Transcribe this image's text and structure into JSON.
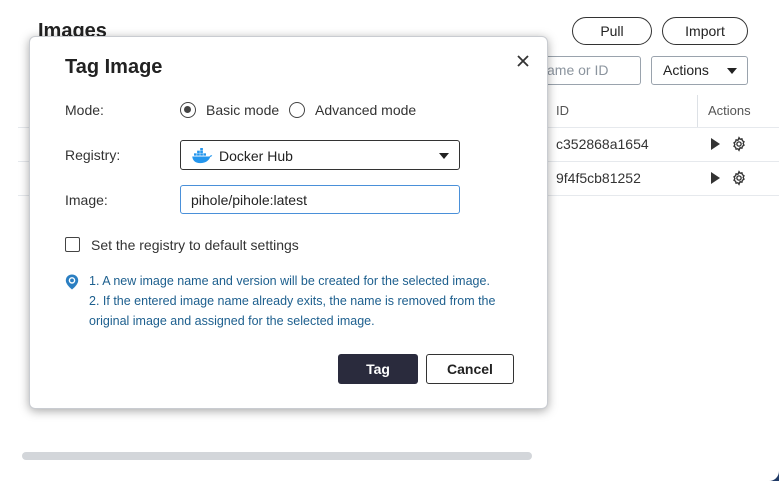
{
  "background": {
    "page_title": "Images",
    "pull_label": "Pull",
    "import_label": "Import",
    "search_placeholder": "ame or ID",
    "actions_label": "Actions",
    "table": {
      "headers": {
        "id": "ID",
        "actions": "Actions"
      },
      "rows": [
        {
          "id": "c352868a1654"
        },
        {
          "id": "9f4f5cb81252"
        }
      ]
    }
  },
  "modal": {
    "title": "Tag Image",
    "mode_label": "Mode:",
    "mode_options": [
      {
        "label": "Basic mode",
        "checked": true
      },
      {
        "label": "Advanced mode",
        "checked": false
      }
    ],
    "registry_label": "Registry:",
    "registry_value": "Docker Hub",
    "image_label": "Image:",
    "image_value": "pihole/pihole:latest",
    "default_settings_label": "Set the registry to default settings",
    "default_settings_checked": false,
    "info_lines": [
      "1. A new image name and version will be created for the selected image.",
      "2. If the entered image name already exits, the name is removed from the",
      "original image and assigned for the selected image."
    ],
    "tag_button": "Tag",
    "cancel_button": "Cancel"
  },
  "colors": {
    "accent_dark": "#2a2b3d",
    "info_text": "#1d5f8e",
    "docker_blue": "#2496ed",
    "backdrop": "#1f3a66"
  }
}
